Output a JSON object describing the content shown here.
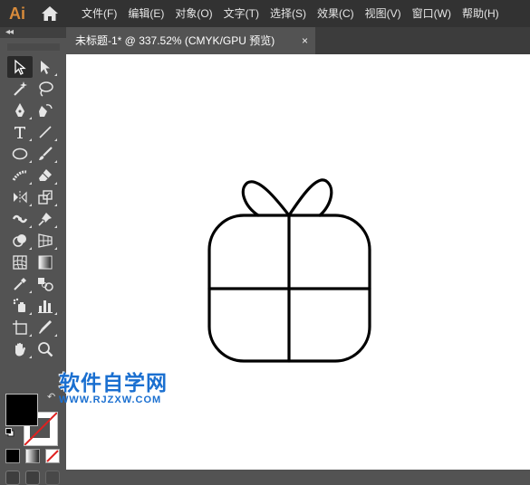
{
  "app": {
    "logo_text": "Ai"
  },
  "menu": [
    "文件(F)",
    "编辑(E)",
    "对象(O)",
    "文字(T)",
    "选择(S)",
    "效果(C)",
    "视图(V)",
    "窗口(W)",
    "帮助(H)"
  ],
  "toolpanel": {
    "collapse_glyph": "◂◂"
  },
  "document": {
    "tab_title": "未标题-1* @ 337.52% (CMYK/GPU 预览)",
    "close_glyph": "×"
  },
  "colors": {
    "accent": "#d88b3b",
    "watermark": "#1a6fd0"
  },
  "tools": [
    [
      "selection-tool-icon",
      "direct-selection-tool-icon"
    ],
    [
      "magic-wand-tool-icon",
      "lasso-tool-icon"
    ],
    [
      "pen-tool-icon",
      "curvature-tool-icon"
    ],
    [
      "type-tool-icon",
      "line-segment-tool-icon"
    ],
    [
      "ellipse-tool-icon",
      "paintbrush-tool-icon"
    ],
    [
      "shaper-tool-icon",
      "eraser-tool-icon"
    ],
    [
      "reflect-tool-icon",
      "scale-tool-icon"
    ],
    [
      "width-tool-icon",
      "puppet-warp-tool-icon"
    ],
    [
      "shape-builder-tool-icon",
      "perspective-grid-tool-icon"
    ],
    [
      "mesh-tool-icon",
      "gradient-tool-icon"
    ],
    [
      "eyedropper-tool-icon",
      "blend-tool-icon"
    ],
    [
      "symbol-sprayer-tool-icon",
      "column-graph-tool-icon"
    ],
    [
      "artboard-tool-icon",
      "slice-tool-icon"
    ],
    [
      "hand-tool-icon",
      "zoom-tool-icon"
    ]
  ],
  "watermark": {
    "title": "软件自学网",
    "url": "WWW.RJZXW.COM"
  }
}
